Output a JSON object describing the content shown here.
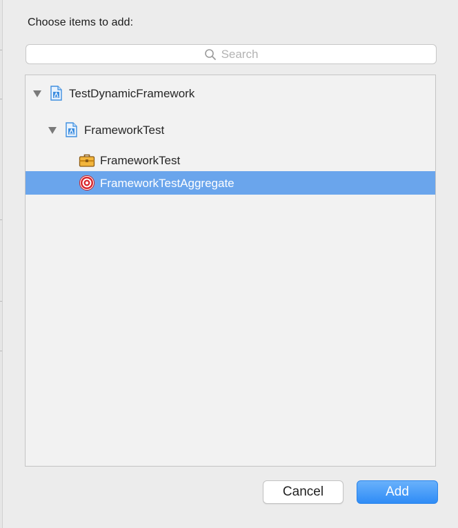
{
  "dialog": {
    "prompt": "Choose items to add:"
  },
  "search": {
    "placeholder": "Search"
  },
  "tree": {
    "items": [
      {
        "label": "TestDynamicFramework",
        "icon": "project-file-icon",
        "expanded": true,
        "selected": false
      },
      {
        "label": "FrameworkTest",
        "icon": "project-file-icon",
        "expanded": true,
        "selected": false
      },
      {
        "label": "FrameworkTest",
        "icon": "framework-toolbox-icon",
        "selected": false
      },
      {
        "label": "FrameworkTestAggregate",
        "icon": "aggregate-target-icon",
        "selected": true
      }
    ]
  },
  "buttons": {
    "cancel": "Cancel",
    "add": "Add"
  },
  "colors": {
    "selection": "#6aa5ec",
    "primary_button": "#2f8cf6",
    "window_background": "#ececec"
  }
}
